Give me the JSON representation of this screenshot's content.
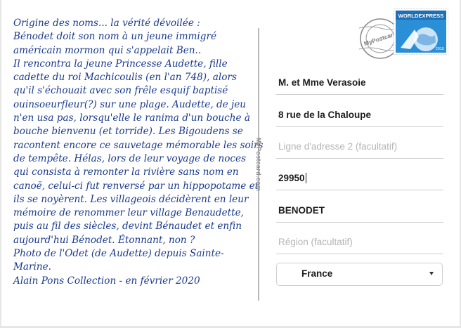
{
  "message": {
    "lines": [
      "Origine des noms... la vérité dévoilée :",
      "Bénodet doit son nom à un jeune immigré",
      "américain mormon qui s'appelait Ben..",
      "Il rencontra la jeune Princesse Audette, fille",
      "cadette du roi Machicoulis (en l'an 748), alors",
      "qu'il s'échouait avec son frêle esquif baptisé",
      "ouinsoeurfleur(?) sur une plage. Audette, de jeu",
      "n'en usa pas, lorsqu'elle le ranima d'un bouche à",
      "bouche bienvenu (et torride). Les Bigoudens se",
      "racontent encore ce sauvetage mémorable les soirs",
      "de tempête.  Hélas, lors de leur voyage de noces",
      "qui consista à remonter la rivière sans nom en",
      "canoë, celui-ci fut renversé par un hippopotame et",
      "ils se noyèrent. Les villageois décidèrent en leur",
      "mémoire de renommer leur village Benaudette,",
      "puis au fil des siècles,  devint Bénaudet et enfin",
      "aujourd'hui Bénodet. Étonnant, non ?",
      "Photo de l'Odet (de Audette) depuis Sainte-",
      "Marine.",
      "Alain Pons Collection - en février 2020"
    ]
  },
  "brand": {
    "vertical_text": "MyPostcard.com"
  },
  "address": {
    "name": "M. et Mme Verasoie",
    "line1": "8 rue de la Chaloupe",
    "line2_placeholder": "Ligne d'adresse 2 (facultatif)",
    "zip": "29950",
    "city": "BENODET",
    "region_placeholder": "Région (facultatif)",
    "country": "France"
  },
  "stamp": {
    "brand_text": "WORLDEXPRESS",
    "year": "2015",
    "postmark_text": "MyPostcard",
    "colors": {
      "sky": "#2a8fd6",
      "banner": "#1e6fb4",
      "earth": "#e9f2fb"
    }
  }
}
